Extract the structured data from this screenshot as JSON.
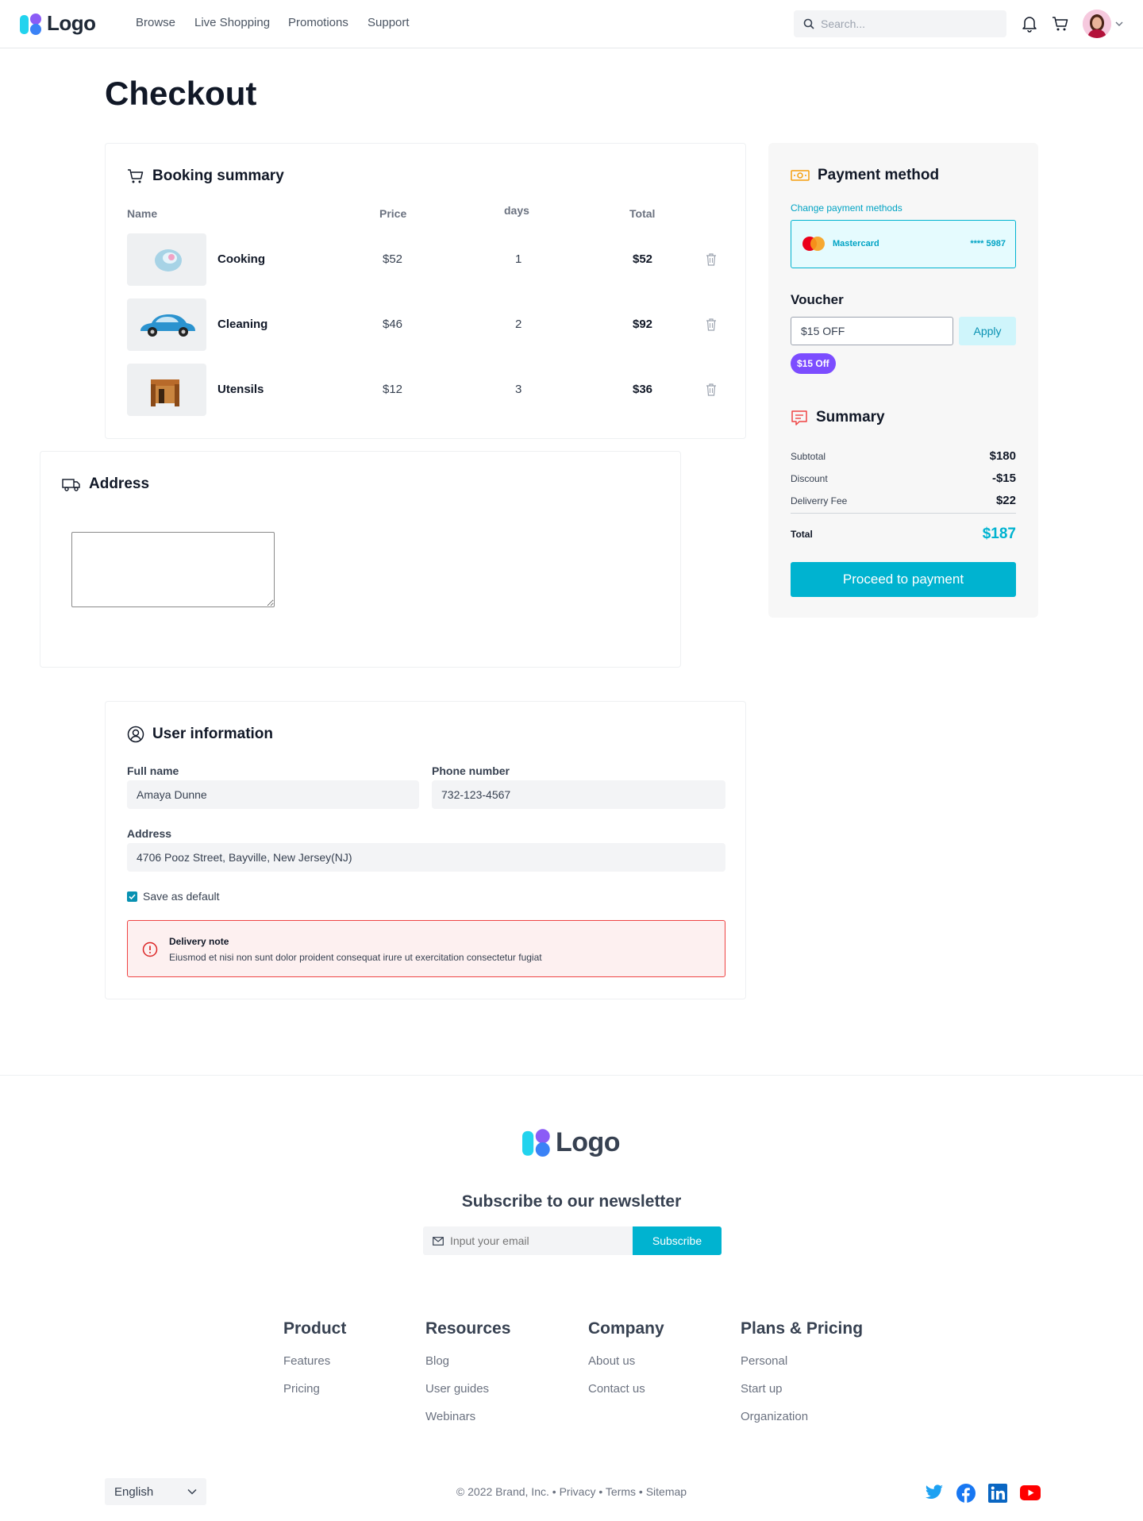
{
  "header": {
    "logo_text": "Logo",
    "nav": [
      "Browse",
      "Live Shopping",
      "Promotions",
      "Support"
    ],
    "search_placeholder": "Search..."
  },
  "page_title": "Checkout",
  "booking": {
    "title": "Booking summary",
    "columns": {
      "name": "Name",
      "price": "Price",
      "days": "days",
      "total": "Total"
    },
    "items": [
      {
        "name": "Cooking",
        "price": "$52",
        "days": "1",
        "total": "$52"
      },
      {
        "name": "Cleaning",
        "price": "$46",
        "days": "2",
        "total": "$92"
      },
      {
        "name": "Utensils",
        "price": "$12",
        "days": "3",
        "total": "$36"
      }
    ]
  },
  "address_card": {
    "title": "Address",
    "textarea_value": ""
  },
  "payment": {
    "title": "Payment method",
    "change_link": "Change payment methods",
    "card_brand": "Mastercard",
    "card_number": "**** 5987",
    "voucher_title": "Voucher",
    "voucher_value": "$15 OFF",
    "apply_label": "Apply",
    "voucher_badge": "$15 Off",
    "summary_title": "Summary",
    "rows": [
      {
        "label": "Subtotal",
        "value": "$180"
      },
      {
        "label": "Discount",
        "value": "-$15"
      },
      {
        "label": "Deliverry Fee",
        "value": "$22"
      }
    ],
    "total_label": "Total",
    "total_value": "$187",
    "proceed_label": "Proceed to payment",
    "accent": "#00b3d0"
  },
  "user_info": {
    "title": "User information",
    "full_name_label": "Full name",
    "full_name": "Amaya Dunne",
    "phone_label": "Phone number",
    "phone": "732-123-4567",
    "address_label": "Address",
    "address": "4706 Pooz Street, Bayville, New Jersey(NJ)",
    "save_default_label": "Save as default",
    "save_default_checked": true,
    "note_title": "Delivery note",
    "note_text": "Eiusmod et nisi non sunt dolor proident consequat irure ut exercitation consectetur fugiat"
  },
  "footer": {
    "logo_text": "Logo",
    "newsletter_title": "Subscribe to our newsletter",
    "email_placeholder": "Input your email",
    "subscribe_label": "Subscribe",
    "columns": [
      {
        "title": "Product",
        "links": [
          "Features",
          "Pricing"
        ]
      },
      {
        "title": "Resources",
        "links": [
          "Blog",
          "User guides",
          "Webinars"
        ]
      },
      {
        "title": "Company",
        "links": [
          "About us",
          "Contact us"
        ]
      },
      {
        "title": "Plans & Pricing",
        "links": [
          "Personal",
          "Start up",
          "Organization"
        ]
      }
    ],
    "language": "English",
    "copyright": "© 2022 Brand, Inc.",
    "legal_links": [
      "Privacy",
      "Terms",
      "Sitemap"
    ],
    "social_icons": [
      "twitter-icon",
      "facebook-icon",
      "linkedin-icon",
      "youtube-icon"
    ]
  }
}
